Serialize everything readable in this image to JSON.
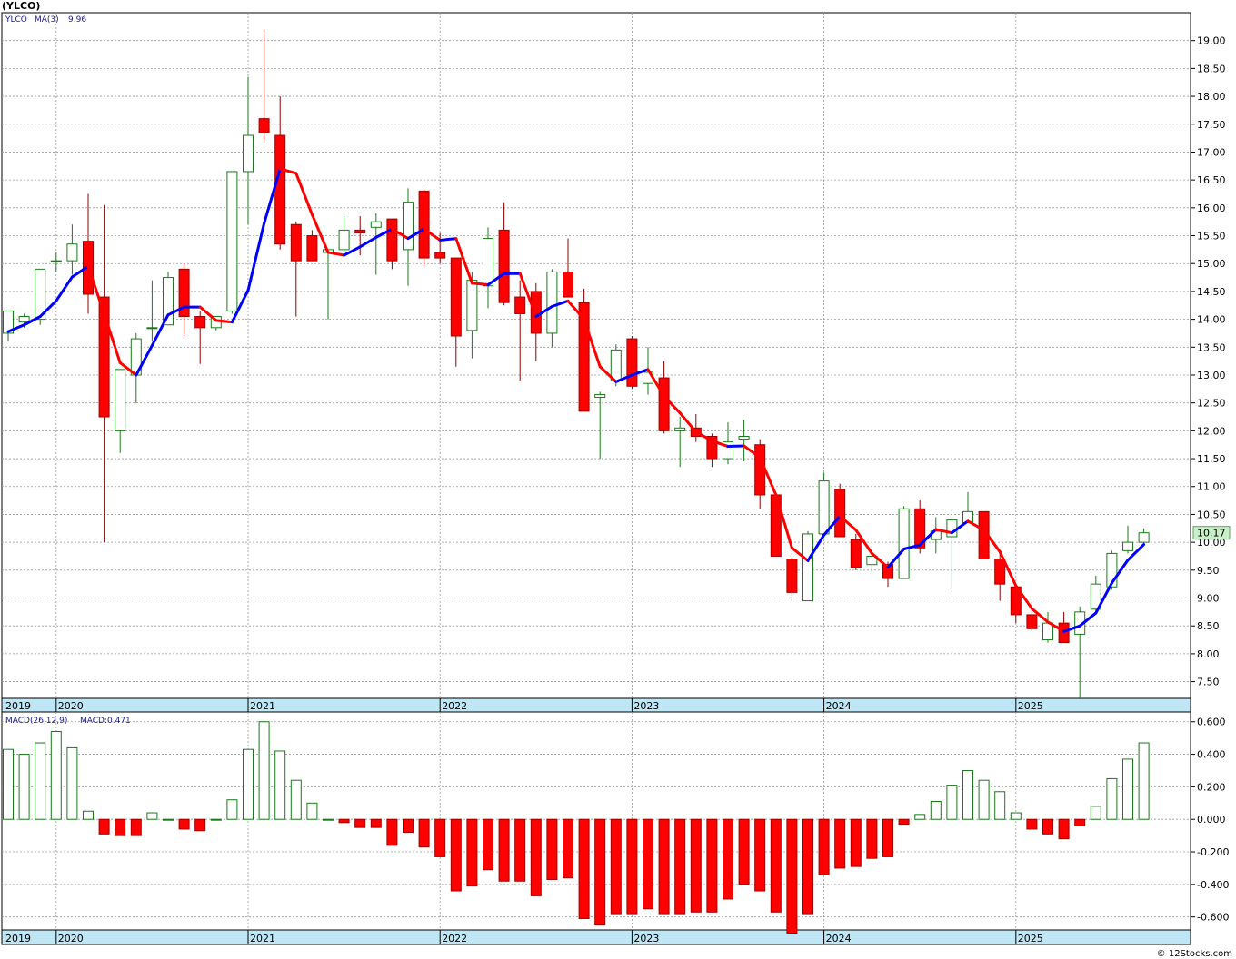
{
  "title": "(YLCO)",
  "copyright": "© 12Stocks.com",
  "colors": {
    "up": "#1a7a1a",
    "down": "#ff0000",
    "ma_up": "#0000ff",
    "ma_down": "#ff0000",
    "grid": "#9a9a9a",
    "axis_band": "#bfe6f4",
    "last_price_bg": "#c7f0c7"
  },
  "chart_data": [
    {
      "type": "candlestick",
      "frequency": "monthly",
      "legend": {
        "symbol": "YLCO",
        "ma_label": "MA(3)",
        "ma_value": "9.96"
      },
      "last_price_label": "10.17",
      "ylim": [
        7.2,
        19.5
      ],
      "y_ticks": [
        "7.50",
        "8.00",
        "8.50",
        "9.00",
        "9.50",
        "10.00",
        "10.50",
        "11.00",
        "11.50",
        "12.00",
        "12.50",
        "13.00",
        "13.50",
        "14.00",
        "14.50",
        "15.00",
        "15.50",
        "16.00",
        "16.50",
        "17.00",
        "17.50",
        "18.00",
        "18.50",
        "19.00"
      ],
      "x_labels": [
        "2019",
        "2020",
        "2021",
        "2022",
        "2023",
        "2024",
        "2025"
      ],
      "candles": [
        [
          13.75,
          14.15,
          13.6,
          14.15
        ],
        [
          13.95,
          14.1,
          13.85,
          14.05
        ],
        [
          14.0,
          14.9,
          13.9,
          14.9
        ],
        [
          15.05,
          15.2,
          14.85,
          15.05
        ],
        [
          15.05,
          15.7,
          14.8,
          15.35
        ],
        [
          15.4,
          16.25,
          14.1,
          14.45
        ],
        [
          14.4,
          16.05,
          10.0,
          12.25
        ],
        [
          12.0,
          13.1,
          11.6,
          13.1
        ],
        [
          13.0,
          13.75,
          12.5,
          13.65
        ],
        [
          13.85,
          14.7,
          13.6,
          13.85
        ],
        [
          13.9,
          14.85,
          13.9,
          14.75
        ],
        [
          14.9,
          15.0,
          13.7,
          14.05
        ],
        [
          14.05,
          14.15,
          13.2,
          13.85
        ],
        [
          13.85,
          14.05,
          13.8,
          14.05
        ],
        [
          14.15,
          16.35,
          14.1,
          16.65
        ],
        [
          16.65,
          18.35,
          15.7,
          17.3
        ],
        [
          17.6,
          19.2,
          17.2,
          17.35
        ],
        [
          17.3,
          18.0,
          15.25,
          15.35
        ],
        [
          15.7,
          15.75,
          14.05,
          15.05
        ],
        [
          15.5,
          15.6,
          15.1,
          15.05
        ],
        [
          15.2,
          15.25,
          14.0,
          15.25
        ],
        [
          15.25,
          15.85,
          15.2,
          15.6
        ],
        [
          15.6,
          15.85,
          15.15,
          15.55
        ],
        [
          15.65,
          15.9,
          14.8,
          15.75
        ],
        [
          15.8,
          15.8,
          14.9,
          15.05
        ],
        [
          15.25,
          16.35,
          14.6,
          16.1
        ],
        [
          16.3,
          16.35,
          14.95,
          15.1
        ],
        [
          15.2,
          15.55,
          15.0,
          15.1
        ],
        [
          15.1,
          15.1,
          13.15,
          13.7
        ],
        [
          13.8,
          14.85,
          13.3,
          14.7
        ],
        [
          14.6,
          15.65,
          14.2,
          15.45
        ],
        [
          15.6,
          16.1,
          14.25,
          14.3
        ],
        [
          14.4,
          14.7,
          12.9,
          14.1
        ],
        [
          14.5,
          14.65,
          13.25,
          13.75
        ],
        [
          13.75,
          14.9,
          13.5,
          14.85
        ],
        [
          14.85,
          15.45,
          14.4,
          14.4
        ],
        [
          14.3,
          14.55,
          12.4,
          12.35
        ],
        [
          12.6,
          12.7,
          11.5,
          12.65
        ],
        [
          12.9,
          13.55,
          12.8,
          13.45
        ],
        [
          13.65,
          13.7,
          12.75,
          12.8
        ],
        [
          12.85,
          13.5,
          12.65,
          13.05
        ],
        [
          12.95,
          13.25,
          11.95,
          12.0
        ],
        [
          12.0,
          12.25,
          11.35,
          12.05
        ],
        [
          12.05,
          12.3,
          11.8,
          11.9
        ],
        [
          11.9,
          11.95,
          11.35,
          11.5
        ],
        [
          11.5,
          12.15,
          11.4,
          11.8
        ],
        [
          11.85,
          12.2,
          11.45,
          11.9
        ],
        [
          11.75,
          11.85,
          10.6,
          10.85
        ],
        [
          10.85,
          10.9,
          9.75,
          9.75
        ],
        [
          9.7,
          9.8,
          8.95,
          9.1
        ],
        [
          8.95,
          10.2,
          8.95,
          10.15
        ],
        [
          10.15,
          11.25,
          10.15,
          11.1
        ],
        [
          10.95,
          11.05,
          10.15,
          10.1
        ],
        [
          10.05,
          10.15,
          9.5,
          9.55
        ],
        [
          9.6,
          9.95,
          9.45,
          9.75
        ],
        [
          9.6,
          9.65,
          9.2,
          9.35
        ],
        [
          9.35,
          10.65,
          9.35,
          10.6
        ],
        [
          10.6,
          10.75,
          9.8,
          9.9
        ],
        [
          10.05,
          10.45,
          9.8,
          10.2
        ],
        [
          10.1,
          10.6,
          9.1,
          10.4
        ],
        [
          10.35,
          10.9,
          10.35,
          10.55
        ],
        [
          10.55,
          10.55,
          9.7,
          9.7
        ],
        [
          9.7,
          9.8,
          8.95,
          9.25
        ],
        [
          9.2,
          9.2,
          8.55,
          8.7
        ],
        [
          8.7,
          8.95,
          8.4,
          8.45
        ],
        [
          8.25,
          8.75,
          8.2,
          8.55
        ],
        [
          8.55,
          8.75,
          8.2,
          8.2
        ],
        [
          8.35,
          8.85,
          7.2,
          8.75
        ],
        [
          8.8,
          9.4,
          8.7,
          9.25
        ],
        [
          9.2,
          9.85,
          9.15,
          9.8
        ],
        [
          9.85,
          10.3,
          9.8,
          10.0
        ],
        [
          10.0,
          10.25,
          9.95,
          10.17
        ]
      ],
      "ma": [
        13.78,
        13.9,
        14.05,
        14.33,
        14.76,
        14.95,
        14.1,
        13.22,
        13.0,
        13.53,
        14.08,
        14.22,
        14.22,
        13.98,
        13.95,
        14.52,
        15.72,
        16.7,
        16.62,
        15.88,
        15.2,
        15.15,
        15.3,
        15.47,
        15.62,
        15.45,
        15.62,
        15.42,
        15.45,
        14.65,
        14.62,
        14.82,
        14.82,
        14.05,
        14.23,
        14.33,
        14.0,
        13.15,
        12.88,
        13.0,
        13.1,
        12.62,
        12.32,
        11.98,
        11.82,
        11.72,
        11.73,
        11.52,
        10.85,
        9.9,
        9.67,
        10.13,
        10.47,
        10.22,
        9.8,
        9.55,
        9.88,
        9.95,
        10.23,
        10.17,
        10.38,
        10.22,
        9.83,
        9.22,
        8.81,
        8.57,
        8.4,
        8.5,
        8.73,
        9.27,
        9.68,
        9.96
      ]
    },
    {
      "type": "bar",
      "name": "MACD(26,12,9)",
      "value_label": "MACD:0.471",
      "ylim": [
        -0.68,
        0.66
      ],
      "y_ticks": [
        "0.600",
        "0.400",
        "0.200",
        "0.000",
        "-0.200",
        "-0.400",
        "-0.600"
      ],
      "values": [
        0.43,
        0.4,
        0.47,
        0.54,
        0.44,
        0.05,
        -0.09,
        -0.1,
        -0.1,
        0.04,
        0.0,
        -0.06,
        -0.07,
        0.0,
        0.12,
        0.43,
        0.6,
        0.42,
        0.24,
        0.1,
        0.0,
        -0.02,
        -0.05,
        -0.05,
        -0.16,
        -0.08,
        -0.17,
        -0.23,
        -0.44,
        -0.41,
        -0.31,
        -0.38,
        -0.38,
        -0.47,
        -0.37,
        -0.36,
        -0.61,
        -0.65,
        -0.58,
        -0.58,
        -0.55,
        -0.58,
        -0.58,
        -0.57,
        -0.57,
        -0.49,
        -0.4,
        -0.44,
        -0.57,
        -0.7,
        -0.58,
        -0.34,
        -0.3,
        -0.29,
        -0.24,
        -0.23,
        -0.03,
        0.03,
        0.11,
        0.21,
        0.3,
        0.24,
        0.17,
        0.04,
        -0.06,
        -0.09,
        -0.12,
        -0.04,
        0.08,
        0.25,
        0.37,
        0.47
      ]
    }
  ]
}
